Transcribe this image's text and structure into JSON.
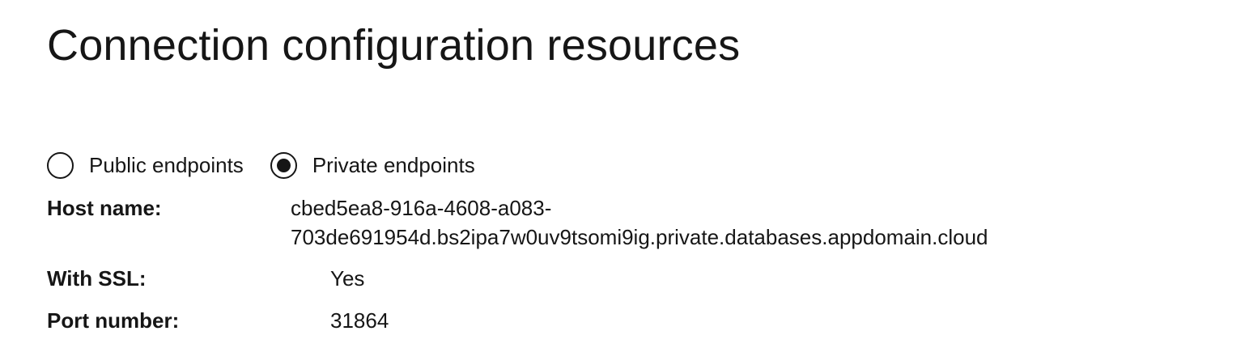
{
  "page": {
    "title": "Connection configuration resources"
  },
  "endpoint_selector": {
    "options": [
      {
        "label": "Public endpoints",
        "selected": false
      },
      {
        "label": "Private endpoints",
        "selected": true
      }
    ]
  },
  "details": {
    "host_name": {
      "label": "Host name:",
      "value_line1": "cbed5ea8-916a-4608-a083-",
      "value_line2": "703de691954d.bs2ipa7w0uv9tsomi9ig.private.databases.appdomain.cloud"
    },
    "ssl": {
      "label": "With SSL:",
      "value": "Yes"
    },
    "port": {
      "label": "Port number:",
      "value": "31864"
    }
  },
  "colors": {
    "text": "#161616",
    "background": "#ffffff"
  }
}
